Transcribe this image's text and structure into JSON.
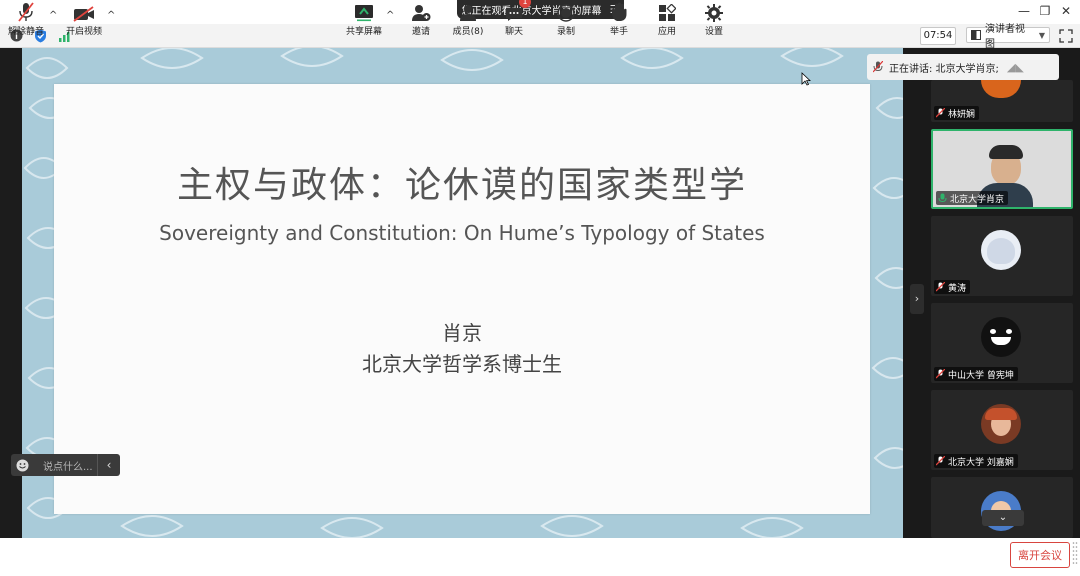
{
  "window": {
    "share_banner": "您正在观看北京大学肖京的屏幕",
    "timer": "07:54",
    "view_mode": "演讲者视图"
  },
  "slide": {
    "title": "主权与政体：论休谟的国家类型学",
    "subtitle": "Sovereignty and Constitution: On Hume’s Typology of States",
    "author": "肖京",
    "affiliation": "北京大学哲学系博士生"
  },
  "chat": {
    "placeholder": "说点什么..."
  },
  "speaking": {
    "label": "正在讲话: 北京大学肖京;"
  },
  "participants": [
    {
      "name": "林妍娴"
    },
    {
      "name": "北京大学肖京"
    },
    {
      "name": "黄涛"
    },
    {
      "name": "中山大学 曾宪坤"
    },
    {
      "name": "北京大学 刘嘉娴"
    }
  ],
  "controls": {
    "unmute": "解除静音",
    "start_video": "开启视频",
    "share_screen": "共享屏幕",
    "invite": "邀请",
    "members": "成员(8)",
    "chat": "聊天",
    "chat_badge": "1",
    "record": "录制",
    "raise_hand": "举手",
    "apps": "应用",
    "settings": "设置",
    "leave": "离开会议"
  },
  "colors": {
    "leave": "#d8453f",
    "active_speaker": "#2fb36b",
    "slide_background": "#a9cbd9",
    "share_icon": "#2fb36b"
  }
}
